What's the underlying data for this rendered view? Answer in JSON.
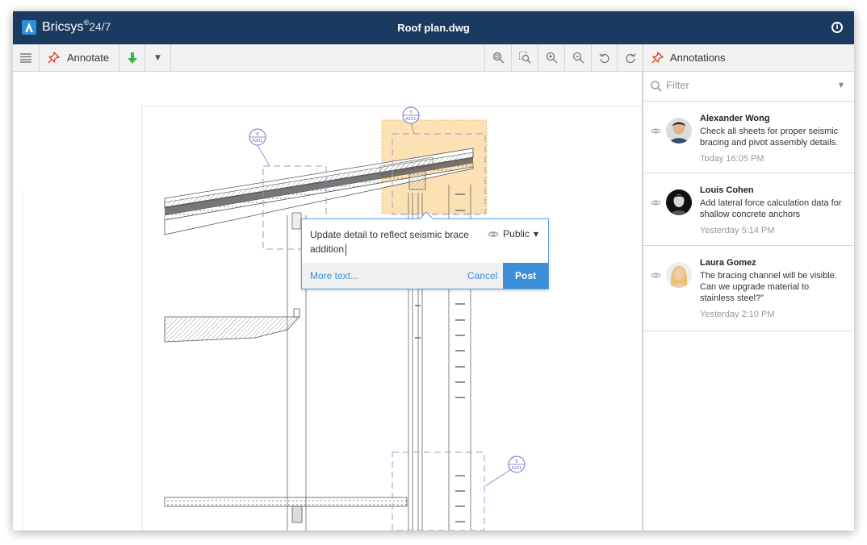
{
  "app": {
    "brand": "Bricsys",
    "brand_sup": "®",
    "brand_version": "24/7",
    "title": "Roof plan.dwg"
  },
  "toolbar": {
    "annotate_label": "Annotate"
  },
  "panel": {
    "title": "Annotations",
    "filter_placeholder": "Filter",
    "comments": [
      {
        "name": "Alexander Wong",
        "text": "Check all sheets for proper seismic bracing and pivot assembly details.",
        "time": "Today 16:05 PM"
      },
      {
        "name": "Louis Cohen",
        "text": "Add lateral force calculation data for shallow concrete anchors",
        "time": "Yesterday 5:14 PM"
      },
      {
        "name": "Laura Gomez",
        "text": "The bracing channel will be visible. Can we upgrade material to stainless steel?\"",
        "time": "Yesterday 2:10 PM"
      }
    ]
  },
  "popup": {
    "text": "Update detail to reflect seismic brace addition",
    "visibility": "Public",
    "more_text": "More text...",
    "cancel": "Cancel",
    "post": "Post"
  },
  "markers": {
    "m1_top": "6",
    "m1_bottom": "A201",
    "m2_top": "5",
    "m2_bottom": "A201",
    "m3_top": "9",
    "m3_bottom": "A201"
  },
  "colors": {
    "titlebar": "#1b3a5f",
    "accent": "#3b8fd8",
    "annotate_red": "#e0452b",
    "download_green": "#3cb54a",
    "highlight": "#fbd89c"
  }
}
